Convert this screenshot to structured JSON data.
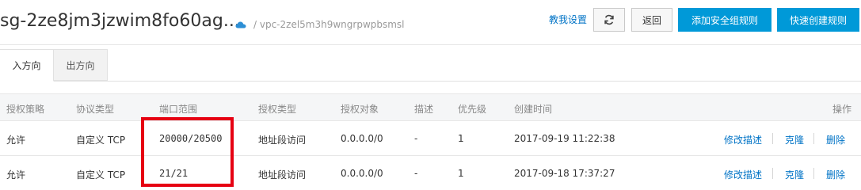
{
  "header": {
    "title": "sg-2ze8jm3jzwim8fo60ag...",
    "cloud_icon": "cloud-icon",
    "vpc": "/ vpc-2zel5m3h9wngrpwpbsmsl",
    "help_link": "教我设置",
    "refresh_icon": "refresh-icon",
    "back_label": "返回",
    "add_rule_label": "添加安全组规则",
    "quick_create_label": "快速创建规则"
  },
  "tabs": [
    {
      "label": "入方向",
      "active": true
    },
    {
      "label": "出方向",
      "active": false
    }
  ],
  "table": {
    "columns": {
      "policy": "授权策略",
      "protocol": "协议类型",
      "port": "端口范围",
      "auth_type": "授权类型",
      "auth_object": "授权对象",
      "description": "描述",
      "priority": "优先级",
      "created": "创建时间",
      "actions": "操作"
    },
    "rows": [
      {
        "policy": "允许",
        "protocol": "自定义 TCP",
        "port": "20000/20500",
        "auth_type": "地址段访问",
        "auth_object": "0.0.0.0/0",
        "description": "-",
        "priority": "1",
        "created": "2017-09-19 11:22:38",
        "edit_desc": "修改描述",
        "clone": "克隆",
        "delete": "删除"
      },
      {
        "policy": "允许",
        "protocol": "自定义 TCP",
        "port": "21/21",
        "auth_type": "地址段访问",
        "auth_object": "0.0.0.0/0",
        "description": "-",
        "priority": "1",
        "created": "2017-09-18 17:37:27",
        "edit_desc": "修改描述",
        "clone": "克隆",
        "delete": "删除"
      }
    ]
  },
  "colors": {
    "primary": "#0099d8",
    "link": "#0073c6",
    "highlight": "#e60012"
  }
}
